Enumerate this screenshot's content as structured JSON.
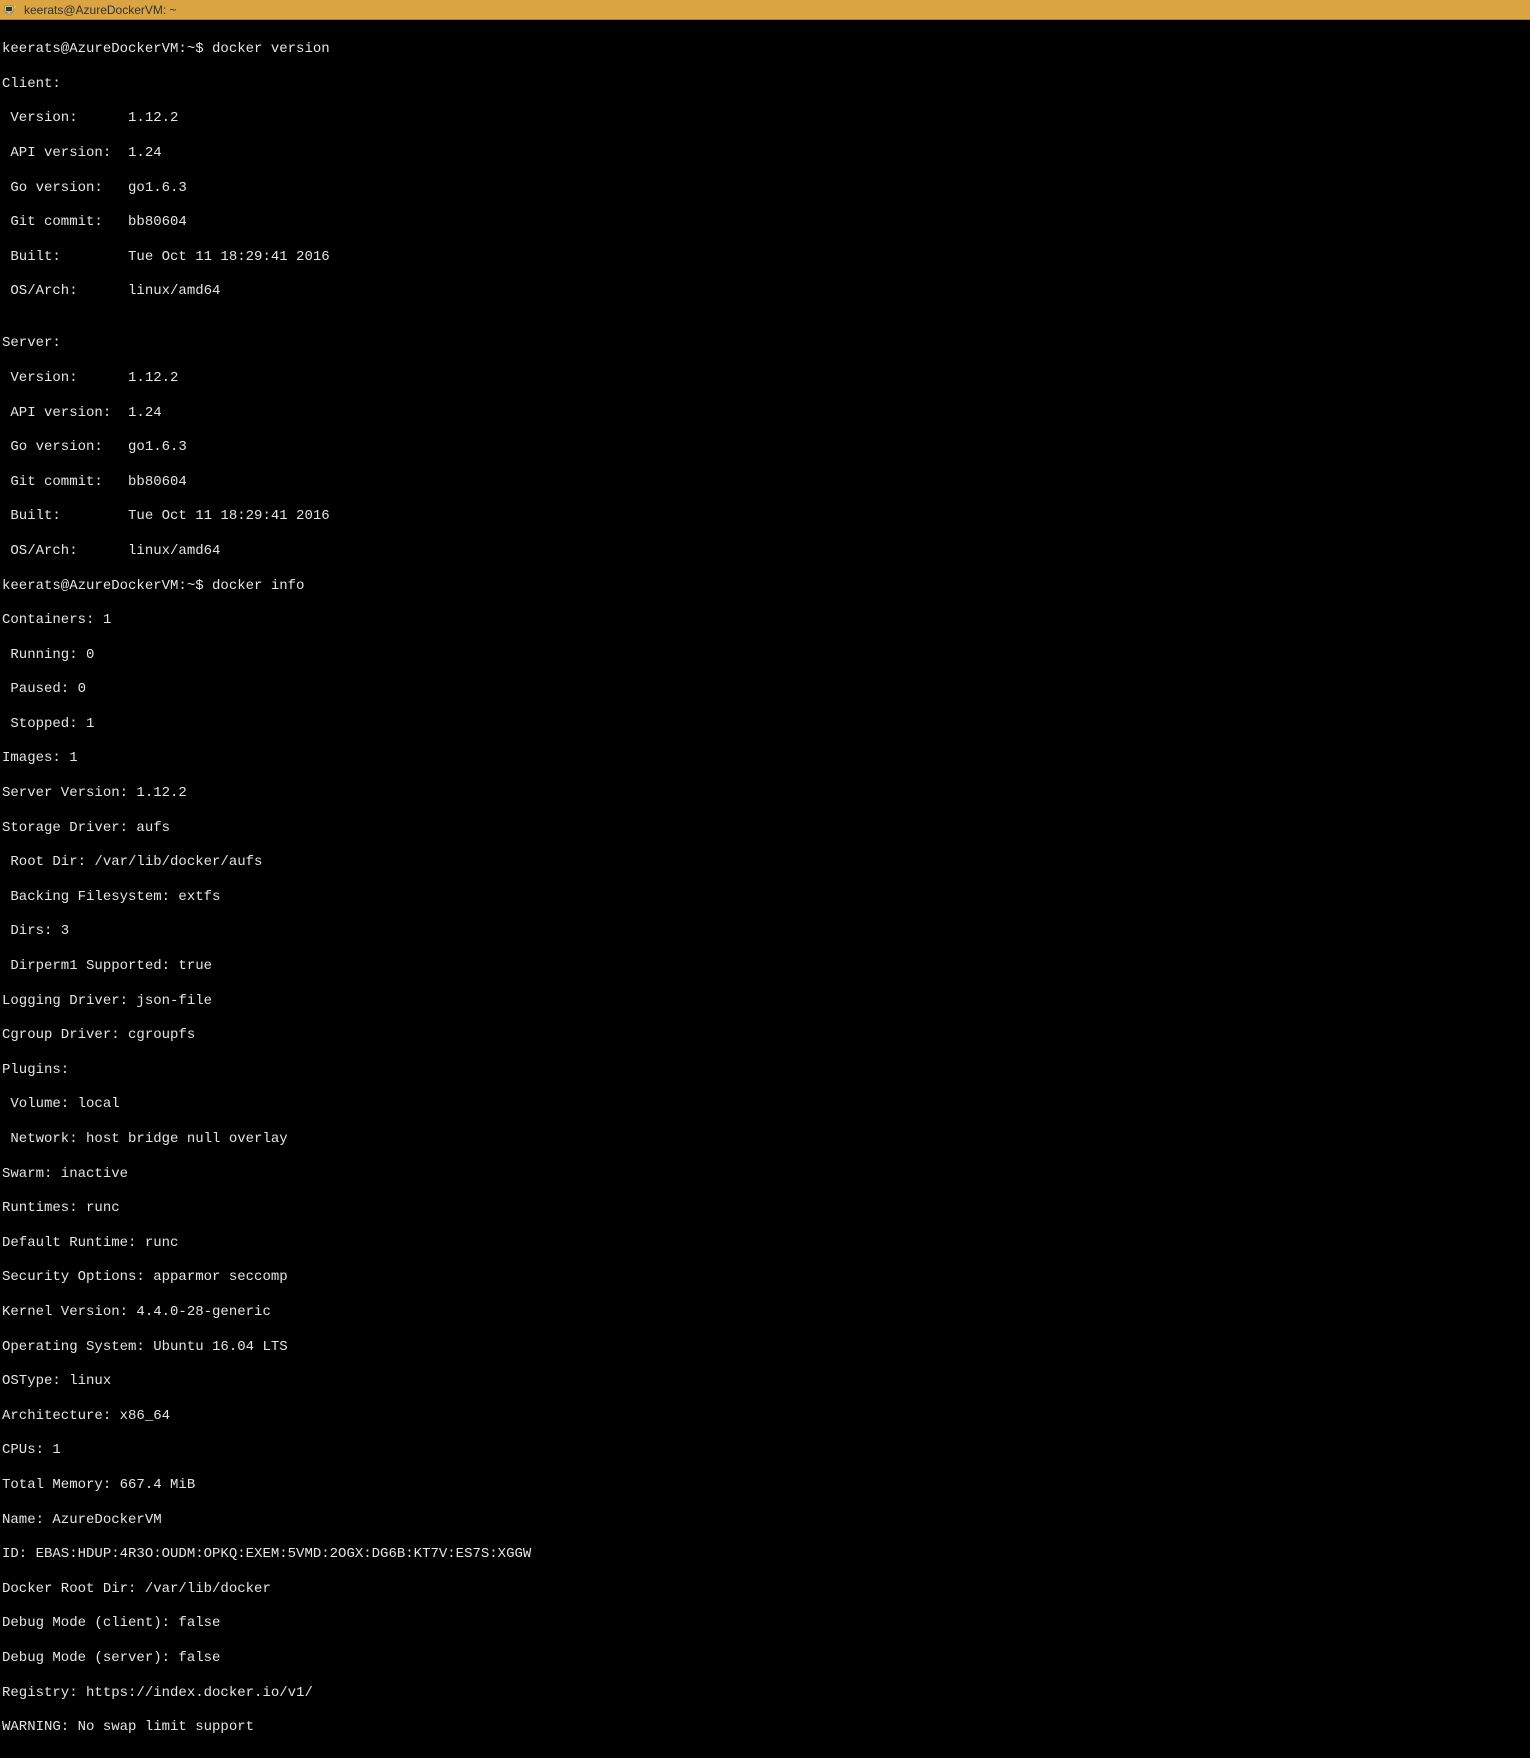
{
  "titlebar": {
    "text": "keerats@AzureDockerVM: ~"
  },
  "terminal": {
    "prompt1": "keerats@AzureDockerVM:~$ docker version",
    "client_header": "Client:",
    "client_version": " Version:      1.12.2",
    "client_api": " API version:  1.24",
    "client_go": " Go version:   go1.6.3",
    "client_git": " Git commit:   bb80604",
    "client_built": " Built:        Tue Oct 11 18:29:41 2016",
    "client_osarch": " OS/Arch:      linux/amd64",
    "blank1": "",
    "server_header": "Server:",
    "server_version": " Version:      1.12.2",
    "server_api": " API version:  1.24",
    "server_go": " Go version:   go1.6.3",
    "server_git": " Git commit:   bb80604",
    "server_built": " Built:        Tue Oct 11 18:29:41 2016",
    "server_osarch": " OS/Arch:      linux/amd64",
    "prompt2": "keerats@AzureDockerVM:~$ docker info",
    "containers": "Containers: 1",
    "running": " Running: 0",
    "paused": " Paused: 0",
    "stopped": " Stopped: 1",
    "images": "Images: 1",
    "server_ver": "Server Version: 1.12.2",
    "storage": "Storage Driver: aufs",
    "rootdir": " Root Dir: /var/lib/docker/aufs",
    "backingfs": " Backing Filesystem: extfs",
    "dirs": " Dirs: 3",
    "dirperm1": " Dirperm1 Supported: true",
    "logging": "Logging Driver: json-file",
    "cgroup": "Cgroup Driver: cgroupfs",
    "plugins": "Plugins:",
    "volume": " Volume: local",
    "network": " Network: host bridge null overlay",
    "swarm": "Swarm: inactive",
    "runtimes": "Runtimes: runc",
    "defrun": "Default Runtime: runc",
    "secopt": "Security Options: apparmor seccomp",
    "kernel": "Kernel Version: 4.4.0-28-generic",
    "os": "Operating System: Ubuntu 16.04 LTS",
    "ostype": "OSType: linux",
    "arch": "Architecture: x86_64",
    "cpus": "CPUs: 1",
    "mem": "Total Memory: 667.4 MiB",
    "name": "Name: AzureDockerVM",
    "id": "ID: EBAS:HDUP:4R3O:OUDM:OPKQ:EXEM:5VMD:2OGX:DG6B:KT7V:ES7S:XGGW",
    "dockerroot": "Docker Root Dir: /var/lib/docker",
    "debugc": "Debug Mode (client): false",
    "debugs": "Debug Mode (server): false",
    "registry": "Registry: https://index.docker.io/v1/",
    "warning": "WARNING: No swap limit support"
  }
}
